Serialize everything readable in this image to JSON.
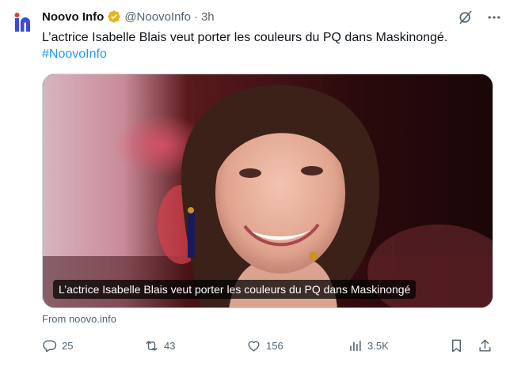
{
  "tweet": {
    "author_name": "Noovo Info",
    "handle": "@NoovoInfo",
    "separator": "·",
    "time": "3h",
    "text": "L’actrice Isabelle Blais veut porter les couleurs du PQ dans Maskinongé.",
    "hashtag": "#NoovoInfo",
    "media_caption": "L’actrice Isabelle Blais veut porter les couleurs du PQ dans Maskinongé",
    "source": "From noovo.info"
  },
  "icons": {
    "avatar": "noovo-logo",
    "verified": "verified-badge-gold",
    "grok": "grok-icon",
    "more": "more-icon",
    "reply": "reply-icon",
    "retweet": "retweet-icon",
    "like": "heart-icon",
    "views": "views-icon",
    "bookmark": "bookmark-icon",
    "share": "share-icon"
  },
  "metrics": {
    "replies": "25",
    "retweets": "43",
    "likes": "156",
    "views": "3.5K"
  },
  "colors": {
    "accent": "#1d9bf0",
    "verified": "#e2b719",
    "logo": "#3a4cd8",
    "muted": "#536471"
  }
}
